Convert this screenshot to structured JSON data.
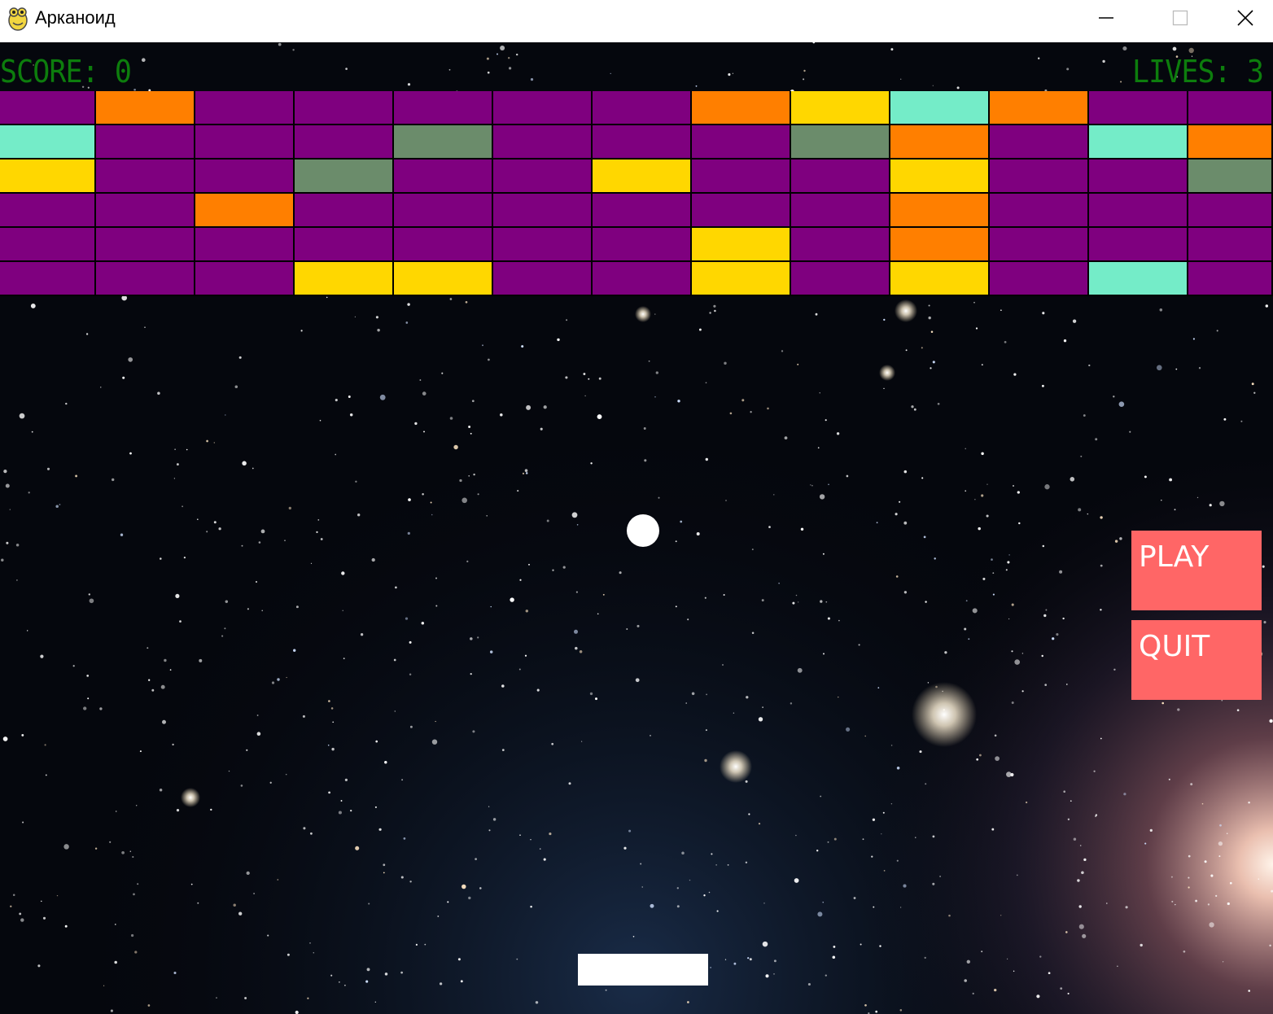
{
  "window": {
    "title": "Арканоид",
    "app_icon": "pygame-snake-icon",
    "controls": [
      "minimize-icon",
      "maximize-icon",
      "close-icon"
    ]
  },
  "hud": {
    "score_label": "SCORE: 0",
    "lives_label": "LIVES: 3",
    "color": "#0d7d0d"
  },
  "colors": {
    "purple": "#7f007f",
    "orange": "#ff7f00",
    "yellow": "#ffd700",
    "teal": "#74ecc8",
    "gray": "#6b8c6b",
    "button": "#ff6666",
    "ball": "#ffffff",
    "paddle": "#ffffff"
  },
  "bricks": {
    "columns": 13,
    "rows": [
      [
        "purple",
        "orange",
        "purple",
        "purple",
        "purple",
        "purple",
        "purple",
        "orange",
        "yellow",
        "teal",
        "orange",
        "purple",
        "purple"
      ],
      [
        "teal",
        "purple",
        "purple",
        "purple",
        "gray",
        "purple",
        "purple",
        "purple",
        "gray",
        "orange",
        "purple",
        "teal",
        "orange"
      ],
      [
        "yellow",
        "purple",
        "purple",
        "gray",
        "purple",
        "purple",
        "yellow",
        "purple",
        "purple",
        "yellow",
        "purple",
        "purple",
        "gray"
      ],
      [
        "purple",
        "purple",
        "orange",
        "purple",
        "purple",
        "purple",
        "purple",
        "purple",
        "purple",
        "orange",
        "purple",
        "purple",
        "purple"
      ],
      [
        "purple",
        "purple",
        "purple",
        "purple",
        "purple",
        "purple",
        "purple",
        "yellow",
        "purple",
        "orange",
        "purple",
        "purple",
        "purple"
      ],
      [
        "purple",
        "purple",
        "purple",
        "yellow",
        "yellow",
        "purple",
        "purple",
        "yellow",
        "purple",
        "yellow",
        "purple",
        "teal",
        "purple"
      ]
    ]
  },
  "menu": {
    "play_label": "PLAY",
    "quit_label": "QUIT"
  }
}
